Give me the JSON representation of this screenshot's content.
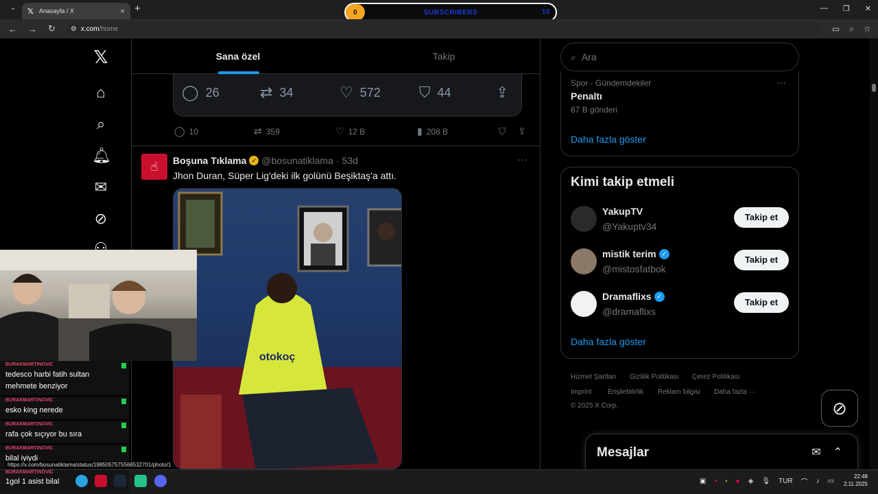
{
  "browser": {
    "tab_title": "Anasayfa / X",
    "url_host": "x.com",
    "url_path": "/home",
    "subscriber_widget": {
      "count": "0",
      "label": "SUBSCRIBERS",
      "goal": "10"
    }
  },
  "feed_tabs": {
    "for_you": "Sana özel",
    "following": "Takip"
  },
  "quoted_actions": {
    "replies": "26",
    "reposts": "34",
    "likes": "572",
    "bookmarks": "44"
  },
  "tweet_actions": {
    "replies": "10",
    "reposts": "359",
    "likes": "12 B",
    "views": "208 B"
  },
  "post": {
    "author_name": "Boşuna Tıklama",
    "author_handle": "@bosunatiklama",
    "time": "53d",
    "text": "Jhon Duran, Süper Lig'deki ilk golünü Beşiktaş'a attı.",
    "photo_alt": "Oyuncu portresi"
  },
  "search": {
    "placeholder": "Ara"
  },
  "trend": {
    "category": "Spor · Gündemdekiler",
    "name": "Penaltı",
    "count": "67 B gönderi",
    "show_more": "Daha fazla göster"
  },
  "who_to_follow": {
    "title": "Kimi takip etmeli",
    "follow_label": "Takip et",
    "show_more": "Daha fazla göster",
    "accounts": [
      {
        "name": "YakupTV",
        "handle": "@Yakuptv34",
        "verified": false
      },
      {
        "name": "mistik terim",
        "handle": "@mistosfatbok",
        "verified": true
      },
      {
        "name": "Dramaflixs",
        "handle": "@dramaflixs",
        "verified": true
      }
    ]
  },
  "footer": {
    "links": [
      "Hizmet Şartları",
      "Gizlilik Politikası",
      "Çerez Politikası",
      "Imprint",
      "Erişilebilirlik",
      "Reklam bilgisi",
      "Daha fazla ···"
    ],
    "copyright": "© 2025 X Corp."
  },
  "messages": {
    "title": "Mesajlar"
  },
  "chat": [
    {
      "user": "BURAKMARTINOVIC",
      "text": "tedesco harbi fatih sultan mehmete benziyor"
    },
    {
      "user": "BURAKMARTINOVIC",
      "text": "esko king nerede"
    },
    {
      "user": "BURAKMARTINOVIC",
      "text": "rafa çok sıçıyor bu sıra"
    },
    {
      "user": "BURAKMARTINOVIC",
      "text": "bilal iyiydi"
    },
    {
      "user": "BURAKMARTINOVIC",
      "text": "1gol 1 asist bilal"
    }
  ],
  "status_url": "https://x.com/bosunatiklama/status/1985057575566532701/photo/1",
  "taskbar": {
    "language": "TUR",
    "time": "22:48",
    "date": "2.11.2025"
  },
  "colors": {
    "accent": "#1d9bf0",
    "background": "#000000",
    "border": "#2f3336"
  }
}
